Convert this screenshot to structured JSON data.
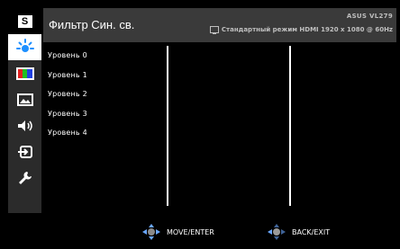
{
  "header": {
    "title": "Фильтр Син. св.",
    "model": "ASUS VL279",
    "status": "Стандартный режим  HDMI 1920 x 1080 @ 60Hz"
  },
  "sidebar": {
    "items": [
      {
        "name": "logo",
        "label": "S"
      },
      {
        "name": "blue-light-icon"
      },
      {
        "name": "color-icon"
      },
      {
        "name": "image-icon"
      },
      {
        "name": "sound-icon"
      },
      {
        "name": "input-select-icon"
      },
      {
        "name": "system-setup-icon"
      }
    ],
    "active_index": 1
  },
  "levels": [
    "Уровень 0",
    "Уровень 1",
    "Уровень 2",
    "Уровень 3",
    "Уровень 4"
  ],
  "footer": {
    "move_label": "MOVE/ENTER",
    "back_label": "BACK/EXIT"
  },
  "colors": {
    "accent": "#1e90ff",
    "header_bg": "#3a3a3a",
    "sidebar_bg": "#2b2b2b"
  }
}
